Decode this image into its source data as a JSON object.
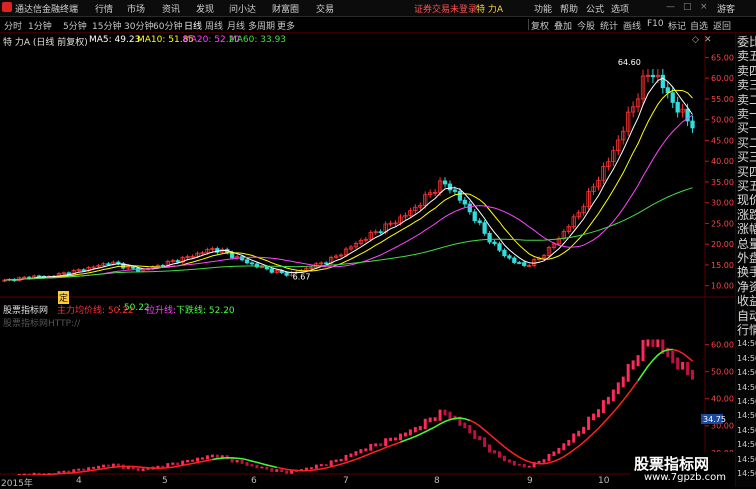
{
  "menu": {
    "app_title": "通达信金融终端",
    "items": [
      "行情",
      "市场",
      "资讯",
      "发现",
      "问小达",
      "财富圈",
      "交易"
    ],
    "login_notice": "证券交易未登录",
    "stock_name": "特 力A",
    "right_items": [
      "功能",
      "帮助",
      "公式",
      "选项"
    ],
    "guest": "游客",
    "window_buttons": [
      "—",
      "□",
      "×"
    ]
  },
  "periods": {
    "items": [
      "分时",
      "1分钟",
      "5分钟",
      "15分钟",
      "30分钟",
      "60分钟",
      "日线",
      "周线",
      "月线",
      "多周期",
      "更多"
    ],
    "active": "日线",
    "tools": [
      "复权",
      "叠加",
      "今股",
      "统计",
      "画线",
      "F10",
      "标记",
      "自选",
      "返回"
    ]
  },
  "main_chart": {
    "title": "特 力A (日线 前复权)",
    "ma": [
      {
        "label": "MA5: 49.23",
        "color": "#ffffff"
      },
      {
        "label": "MA10: 51.85",
        "color": "#ffff00"
      },
      {
        "label": "MA20: 52.20",
        "color": "#ff44ff"
      },
      {
        "label": "MA60: 33.93",
        "color": "#44dd44"
      }
    ],
    "price_axis": [
      "65.00",
      "60.00",
      "55.00",
      "50.00",
      "45.00",
      "40.00",
      "35.00",
      "30.00",
      "25.00",
      "20.00",
      "15.00",
      "10.00"
    ],
    "annotation_high": "64.60",
    "annotation_low": "6.67",
    "mark_label": "定",
    "corner_icons": [
      "◇",
      "✕"
    ]
  },
  "sub_chart": {
    "name": "股票指标网",
    "lines": [
      {
        "label": "主力均价线: 50.22",
        "color": "#ff3030"
      },
      {
        "label": ": 50.22",
        "color": "#44ff44"
      },
      {
        "label": "拉升线: ",
        "color": "#ff44ff"
      },
      {
        "label": "下跌线: 52.20",
        "color": "#44ff44"
      }
    ],
    "watermark_text": "股票指标网HTTP://",
    "axis": [
      "60.00",
      "50.00",
      "40.00",
      "30.00",
      "20.00"
    ],
    "current_value": "34.75"
  },
  "date_axis": {
    "labels": [
      "2015年",
      "4",
      "5",
      "6",
      "7",
      "8",
      "9",
      "10"
    ]
  },
  "right_panel": {
    "items": [
      "委比",
      "卖五",
      "卖四",
      "卖三",
      "卖二",
      "卖一",
      "买一",
      "买二",
      "买三",
      "买四",
      "买五",
      "现价",
      "涨跌",
      "涨幅",
      "总量",
      "外盘",
      "换手",
      "净资",
      "收益",
      "自动",
      "行情",
      "14:50",
      "14:50",
      "14:50",
      "14:50",
      "14:50",
      "14:50",
      "14:50",
      "14:50",
      "14:50",
      "14:50"
    ]
  },
  "watermark": {
    "line1": "股票指标网",
    "line2": "www.7gpzb.com"
  },
  "colors": {
    "up": "#ff3333",
    "down": "#33dddd",
    "ma5": "#ffffff",
    "ma10": "#ffff00",
    "ma20": "#ff44ff",
    "ma60": "#44dd44",
    "grid": "#5a0000"
  },
  "chart_data": {
    "type": "candlestick",
    "price_axis_range": [
      8,
      68
    ],
    "sub_axis_range": [
      14,
      68
    ],
    "closes": [
      11.2,
      11.6,
      11.9,
      12.3,
      12.0,
      12.6,
      13.1,
      13.6,
      14.2,
      14.8,
      15.6,
      15.1,
      14.2,
      13.7,
      14.3,
      15.0,
      15.8,
      16.4,
      17.3,
      18.1,
      18.9,
      18.2,
      17.1,
      15.9,
      14.9,
      14.1,
      13.4,
      12.8,
      13.3,
      14.2,
      15.1,
      16.0,
      17.3,
      19.0,
      20.6,
      22.1,
      23.5,
      24.9,
      26.3,
      28.0,
      30.2,
      32.8,
      34.9,
      33.1,
      29.8,
      26.7,
      22.8,
      19.7,
      17.3,
      15.6,
      14.8,
      16.1,
      18.2,
      20.9,
      24.1,
      27.4,
      31.6,
      36.2,
      40.3,
      45.8,
      51.7,
      57.6,
      62.2,
      58.6,
      54.7,
      51.2,
      49.2
    ]
  }
}
